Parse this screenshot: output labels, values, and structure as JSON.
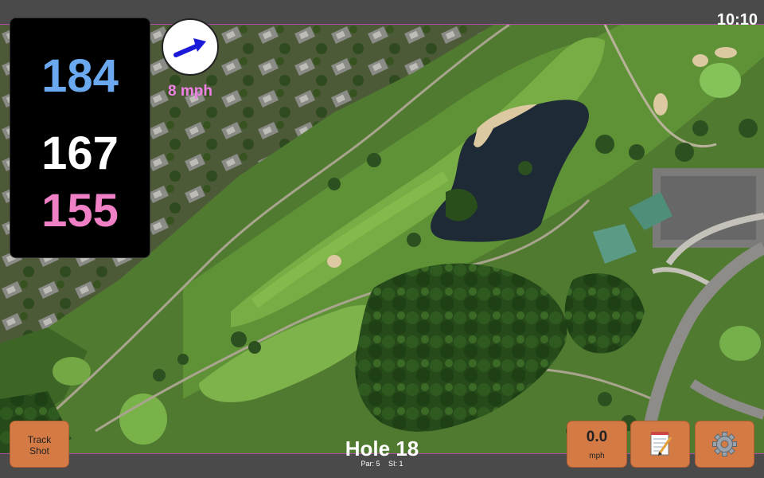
{
  "status_bar": {
    "time": "10:10"
  },
  "yardages": {
    "back": "184",
    "middle": "167",
    "front": "155"
  },
  "wind": {
    "speed_label": "8 mph",
    "icon": "wind-direction-arrow-icon"
  },
  "buttons": {
    "track_shot_line1": "Track",
    "track_shot_line2": "Shot",
    "speed_value": "0.0",
    "speed_unit": "mph",
    "notes_icon": "notepad-icon",
    "settings_icon": "gear-icon"
  },
  "hole": {
    "title": "Hole 18",
    "par_label": "Par: 5",
    "si_label": "SI: 1"
  },
  "colors": {
    "back_yardage": "#6aa9ef",
    "middle_yardage": "#ffffff",
    "front_yardage": "#ef80c6",
    "wind_text": "#ef80e6",
    "button_bg": "#d47a44",
    "wind_arrow": "#1a1ad8"
  }
}
